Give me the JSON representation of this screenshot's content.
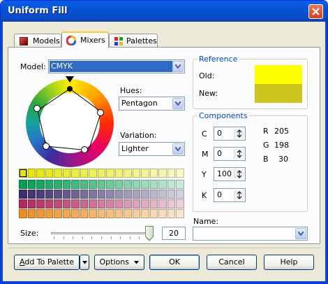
{
  "window": {
    "title": "Uniform Fill"
  },
  "icons": {
    "close": "close-icon",
    "models": "models-icon",
    "mixers": "mixers-icon",
    "palettes": "palettes-icon",
    "dropdown": "chevron-down-icon"
  },
  "tabs": [
    {
      "label": "Models",
      "active": false
    },
    {
      "label": "Mixers",
      "active": true
    },
    {
      "label": "Palettes",
      "active": false
    }
  ],
  "model": {
    "label": "Model:",
    "value": "CMYK"
  },
  "hues": {
    "label": "Hues:",
    "value": "Pentagon"
  },
  "variation": {
    "label": "Variation:",
    "value": "Lighter"
  },
  "reference": {
    "title": "Reference",
    "old_label": "Old:",
    "new_label": "New:",
    "old_color": "#ffff00",
    "new_color": "#cdc61e"
  },
  "components": {
    "title": "Components",
    "c_label": "C",
    "c_value": "0",
    "m_label": "M",
    "m_value": "0",
    "y_label": "Y",
    "y_value": "100",
    "k_label": "K",
    "k_value": "0",
    "r_label": "R",
    "r_value": "205",
    "g_label": "G",
    "g_value": "198",
    "b_label": "B",
    "b_value": "30"
  },
  "size": {
    "label": "Size:",
    "value": "20"
  },
  "name": {
    "label": "Name:",
    "value": ""
  },
  "swatch_colors": [
    "#e6e600",
    "#00a050",
    "#3c2d6e",
    "#b4285a",
    "#f08c1e"
  ],
  "buttons": {
    "add_to_palette_u": "A",
    "add_to_palette_rest": "dd To Palette",
    "options": "Options",
    "ok": "OK",
    "cancel": "Cancel",
    "help": "Help"
  }
}
